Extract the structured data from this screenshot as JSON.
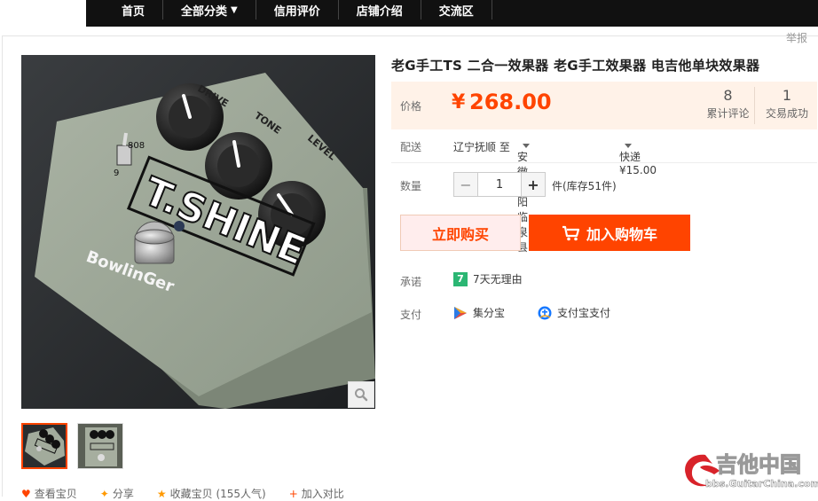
{
  "nav": {
    "items": [
      {
        "label": "首页"
      },
      {
        "label": "全部分类",
        "caret": "▼"
      },
      {
        "label": "信用评价"
      },
      {
        "label": "店铺介绍"
      },
      {
        "label": "交流区"
      }
    ]
  },
  "report": "举报",
  "product": {
    "title": "老G手工TS 二合一效果器 老G手工效果器 电吉他单块效果器",
    "image_text": {
      "brand": "T.SHINE",
      "maker": "BowlinGer",
      "knobs": [
        "DRIVE",
        "TONE",
        "LEVEL"
      ],
      "switch_top": "808",
      "switch_bottom": "9"
    }
  },
  "price": {
    "label": "价格",
    "currency": "¥",
    "value": "268.00",
    "reviews_count": "8",
    "reviews_label": "累计评论",
    "deals_count": "1",
    "deals_label": "交易成功"
  },
  "shipping": {
    "label": "配送",
    "from": "辽宁抚顺 至",
    "to": "安徽阜阳临泉县",
    "method": "快递 ¥15.00"
  },
  "quantity": {
    "label": "数量",
    "value": "1",
    "minus": "−",
    "plus": "+",
    "stock": "件(库存51件)"
  },
  "buttons": {
    "buy_now": "立即购买",
    "add_cart": "加入购物车"
  },
  "promise": {
    "label": "承诺",
    "icon_text": "7",
    "text": "7天无理由"
  },
  "payment": {
    "label": "支付",
    "methods": [
      "集分宝",
      "支付宝支付"
    ]
  },
  "bottom_links": [
    "查看宝贝",
    "分享",
    "收藏宝贝 (155人气)",
    "加入对比"
  ],
  "watermark": {
    "name": "吉他中国",
    "url": "bbs.GuitarChina.com"
  },
  "colors": {
    "accent": "#ff4400",
    "price_bg": "#fff2e8",
    "nav_bg": "#111111"
  }
}
